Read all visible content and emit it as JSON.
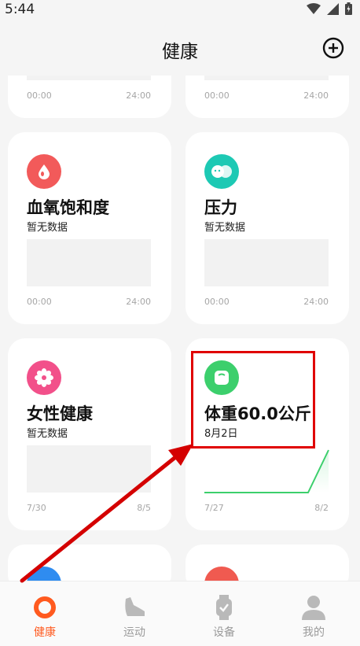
{
  "status_bar": {
    "time": "5:44"
  },
  "header": {
    "title": "健康"
  },
  "top_cards": [
    {
      "axis_start": "00:00",
      "axis_end": "24:00"
    },
    {
      "axis_start": "00:00",
      "axis_end": "24:00"
    }
  ],
  "cards": {
    "blood_oxygen": {
      "title": "血氧饱和度",
      "subtitle": "暂无数据",
      "axis_start": "00:00",
      "axis_end": "24:00",
      "color": "#f25a5a"
    },
    "stress": {
      "title": "压力",
      "subtitle": "暂无数据",
      "axis_start": "00:00",
      "axis_end": "24:00",
      "color": "#1dc9b4"
    },
    "female_health": {
      "title": "女性健康",
      "subtitle": "暂无数据",
      "axis_start": "7/30",
      "axis_end": "8/5",
      "color": "#f2508a"
    },
    "weight": {
      "title": "体重60.0公斤",
      "subtitle": "8月2日",
      "axis_start": "7/27",
      "axis_end": "8/2",
      "color": "#3ccf6c"
    }
  },
  "tabs": [
    {
      "label": "健康",
      "active": true
    },
    {
      "label": "运动",
      "active": false
    },
    {
      "label": "设备",
      "active": false
    },
    {
      "label": "我的",
      "active": false
    }
  ],
  "colors": {
    "accent": "#ff5a1f",
    "annotation": "#e00000"
  }
}
